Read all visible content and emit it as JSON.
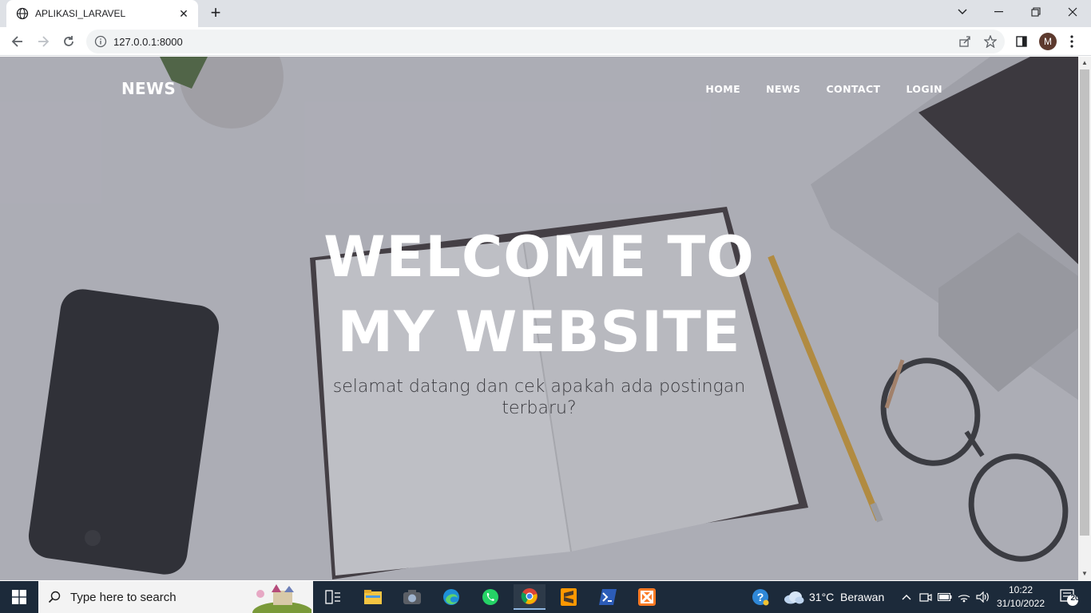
{
  "browser": {
    "tab_title": "APLIKASI_LARAVEL",
    "url": "127.0.0.1:8000",
    "profile_initial": "M"
  },
  "site": {
    "brand": "NEWS",
    "nav": [
      "HOME",
      "NEWS",
      "CONTACT",
      "LOGIN"
    ],
    "hero_title": "WELCOME TO MY WEBSITE",
    "hero_subtitle": "selamat datang dan cek apakah ada postingan terbaru?"
  },
  "taskbar": {
    "search_placeholder": "Type here to search",
    "weather_temp": "31°C",
    "weather_desc": "Berawan",
    "time": "10:22",
    "date": "31/10/2022",
    "notifications": "20",
    "apps": [
      "task-view-icon",
      "file-explorer-icon",
      "camera-icon",
      "edge-icon",
      "whatsapp-icon",
      "chrome-icon",
      "sublime-text-icon",
      "powershell-icon",
      "xampp-icon"
    ]
  },
  "colors": {
    "taskbar": "#1c2a3a",
    "tabstrip": "#dee1e6",
    "overlay": "#5a5c6e"
  }
}
